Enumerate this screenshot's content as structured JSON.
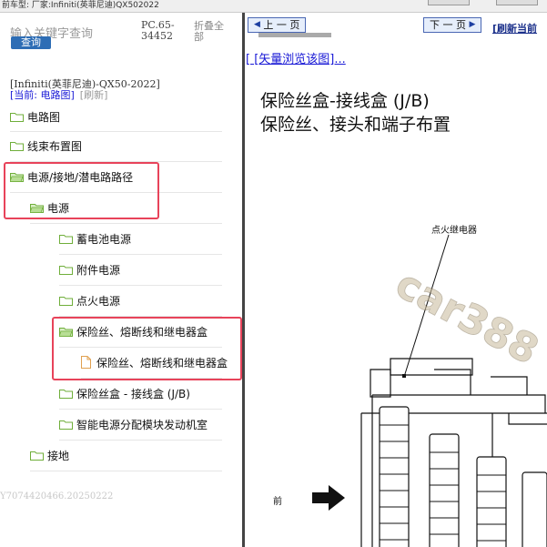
{
  "topbar": {
    "text": "前车型:   厂家:Infiniti(英菲尼迪)QX502022"
  },
  "left": {
    "search_placeholder": "输入关键字查询",
    "query_button": "查询",
    "pc_code": "PC.65-34452",
    "collapse_all": "折叠全部",
    "car_model": "[Infiniti(英菲尼迪)-QX50-2022]",
    "current_label": "[当前: 电路图]",
    "refresh_label": "[刷新]",
    "tree": [
      {
        "label": "电路图"
      },
      {
        "label": "线束布置图"
      },
      {
        "label": "电源/接地/潜电路路径"
      },
      {
        "label": "电源"
      },
      {
        "label": "蓄电池电源"
      },
      {
        "label": "附件电源"
      },
      {
        "label": "点火电源"
      },
      {
        "label": "保险丝、熔断线和继电器盒"
      },
      {
        "label": "保险丝、熔断线和继电器盒"
      },
      {
        "label": "保险丝盒 - 接线盒 (J/B)"
      },
      {
        "label": "智能电源分配模块发动机室"
      },
      {
        "label": "接地"
      }
    ],
    "bottom_code": "Y7074420466.20250222"
  },
  "right": {
    "prev_page": "上 一 页",
    "next_page": "下 一 页",
    "refresh_current": "[刷新当前",
    "vector_link": "[ [矢量浏览该图]...",
    "title_line1": "保险丝盒-接线盒 (J/B)",
    "title_line2": "保险丝、接头和端子布置",
    "callout_ignition_relay": "点火继电器",
    "front_label": "前",
    "watermark": "car388"
  },
  "colors": {
    "highlight_red": "#e8435a",
    "query_blue": "#2d6db5",
    "folder_green": "#6fae3a",
    "link_blue": "#1a1ad6"
  }
}
